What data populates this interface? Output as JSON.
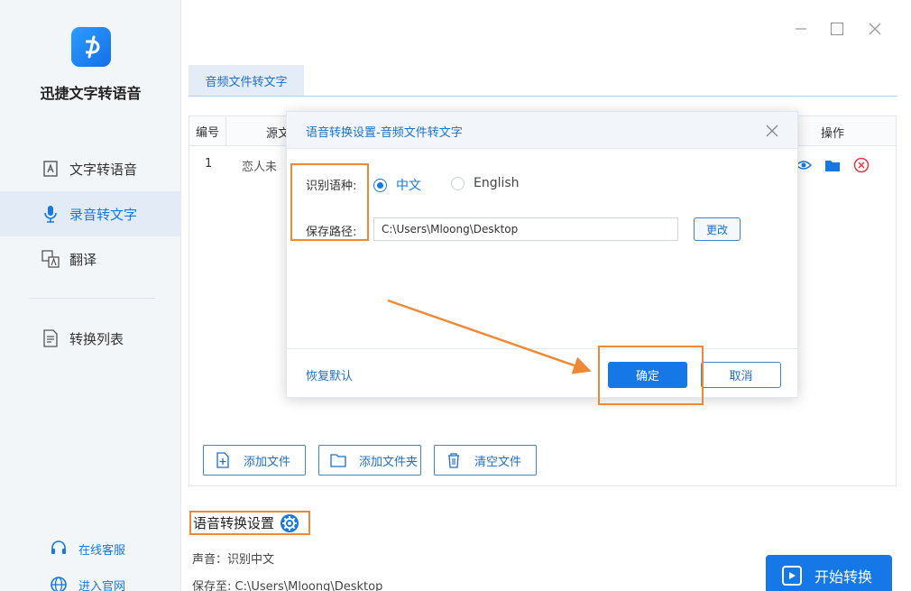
{
  "app": {
    "name": "迅捷文字转语音"
  },
  "sidebar": {
    "items": [
      {
        "label": "文字转语音",
        "icon": "text-doc-icon"
      },
      {
        "label": "录音转文字",
        "icon": "microphone-icon",
        "active": true
      },
      {
        "label": "翻译",
        "icon": "translate-icon"
      },
      {
        "label": "转换列表",
        "icon": "list-icon"
      }
    ],
    "footer": [
      {
        "label": "在线客服",
        "icon": "headset-icon"
      },
      {
        "label": "进入官网",
        "icon": "globe-icon"
      }
    ]
  },
  "tab": {
    "label": "音频文件转文字"
  },
  "table": {
    "headers": {
      "num": "编号",
      "source": "源文",
      "ops": "操作"
    },
    "rows": [
      {
        "num": "1",
        "name": "恋人未"
      }
    ]
  },
  "buttons": {
    "add_file": "添加文件",
    "add_folder": "添加文件夹",
    "clear": "清空文件",
    "start": "开始转换"
  },
  "settings": {
    "title": "语音转换设置",
    "voice": "声音：识别中文",
    "save_to": "保存至: C:\\Users\\Mloong\\Desktop"
  },
  "dialog": {
    "title": "语音转换设置-音频文件转文字",
    "lang_label": "识别语种:",
    "lang_options": [
      "中文",
      "English"
    ],
    "lang_selected": "中文",
    "path_label": "保存路径:",
    "path_value": "C:\\Users\\Mloong\\Desktop",
    "change": "更改",
    "restore": "恢复默认",
    "ok": "确定",
    "cancel": "取消"
  },
  "colors": {
    "accent": "#1677e6",
    "annotation": "#ee8a36",
    "sidebar_bg": "#f3f6f9"
  }
}
